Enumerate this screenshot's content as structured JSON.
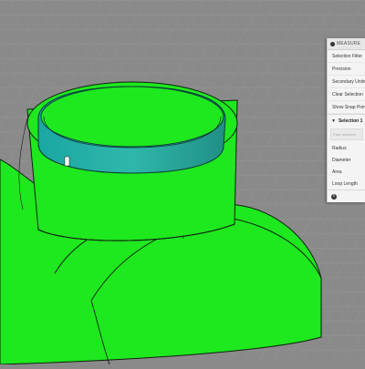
{
  "panel": {
    "title": "MEASURE",
    "options": [
      {
        "label": "Selection Filter"
      },
      {
        "label": "Precision"
      },
      {
        "label": "Secondary Units"
      },
      {
        "label": "Clear Selection"
      },
      {
        "label": "Show Snap Points"
      }
    ],
    "selection": {
      "header": "Selection 1",
      "placeholder": "Face selected",
      "properties": [
        {
          "label": "Radius"
        },
        {
          "label": "Diameter"
        },
        {
          "label": "Area"
        },
        {
          "label": "Loop Length"
        }
      ]
    }
  },
  "scene": {
    "colors": {
      "background": "#8a8a8a",
      "grid": "#9a9a9a",
      "model": "#1ee81e",
      "model_shade": "#14b814",
      "selected_face": "#2aa79c",
      "edge": "#102010"
    }
  }
}
